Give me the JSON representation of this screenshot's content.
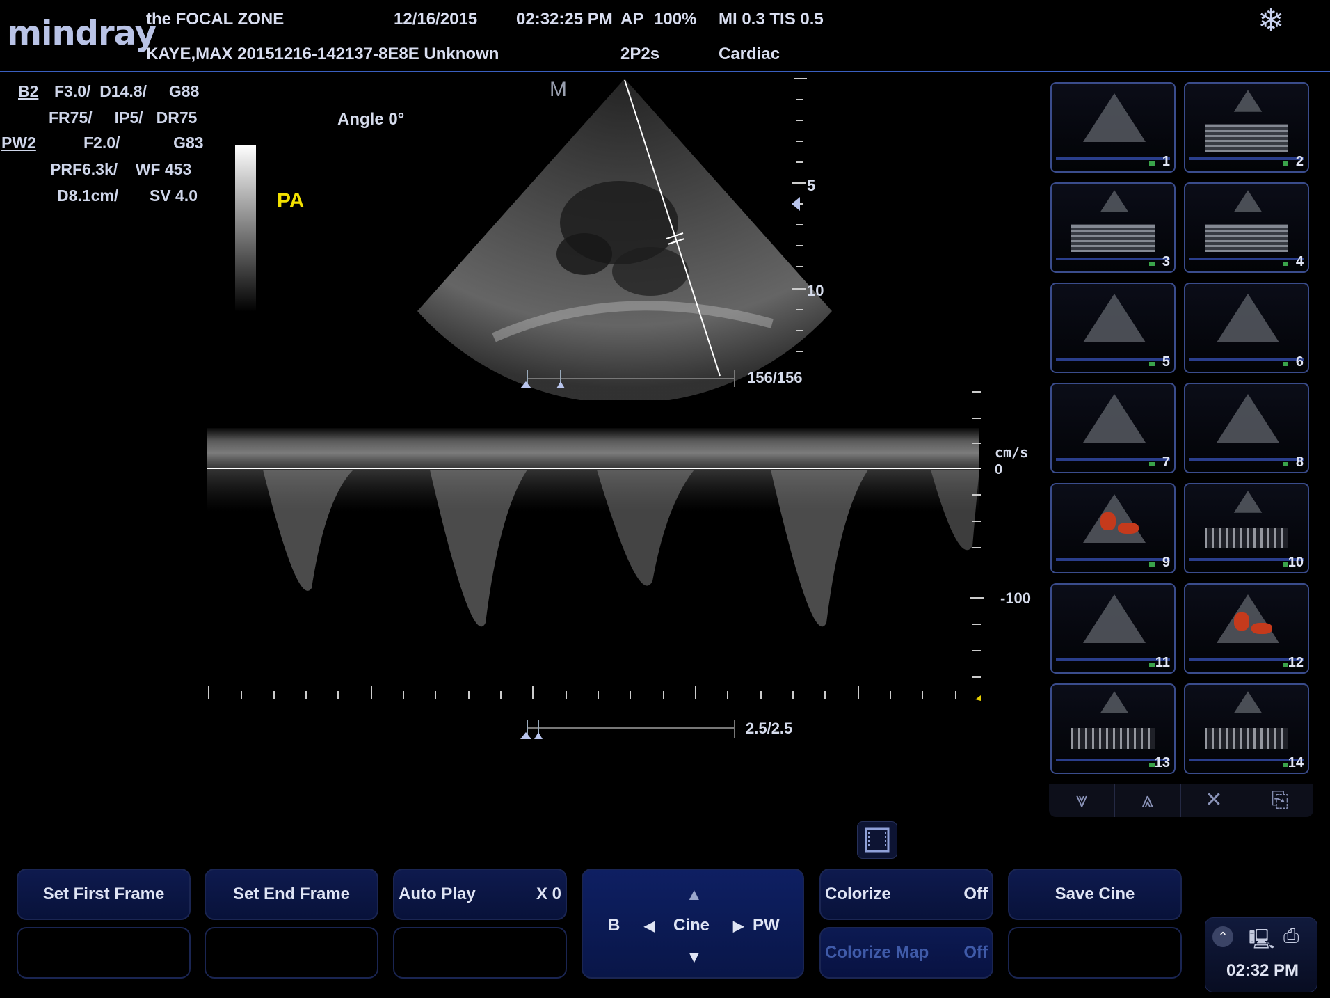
{
  "header": {
    "brand": "mindray",
    "site": "the FOCAL ZONE",
    "date": "12/16/2015",
    "time": "02:32:25 PM",
    "ap": "AP",
    "ap_value": "100%",
    "mi_tis": "MI 0.3 TIS 0.5",
    "patient": "KAYE,MAX 20151216-142137-8E8E Unknown",
    "probe": "2P2s",
    "exam": "Cardiac",
    "freeze_icon": "snowflake-icon"
  },
  "params": {
    "b_label": "B2",
    "b_line1": "F3.0/  D14.8/     G88",
    "b_line2": "FR75/     IP5/   DR75",
    "pw_label": "PW2",
    "pw_line1": "F2.0/            G83",
    "pw_line2": "PRF6.3k/    WF 453",
    "pw_line3": "D8.1cm/       SV 4.0"
  },
  "image": {
    "angle": "Angle 0°",
    "annotation": "PA",
    "marker": "M",
    "depth_5": "5",
    "depth_10": "10",
    "frame_counter": "156/156",
    "velocity_unit": "cm/s",
    "velocity_zero": "0",
    "velocity_neg100": "-100",
    "spectrum_counter": "2.5/2.5"
  },
  "thumbnails": [
    {
      "num": "1",
      "kind": "cone"
    },
    {
      "num": "2",
      "kind": "strip"
    },
    {
      "num": "3",
      "kind": "strip"
    },
    {
      "num": "4",
      "kind": "strip"
    },
    {
      "num": "5",
      "kind": "cone"
    },
    {
      "num": "6",
      "kind": "cone"
    },
    {
      "num": "7",
      "kind": "cone"
    },
    {
      "num": "8",
      "kind": "cone"
    },
    {
      "num": "9",
      "kind": "color"
    },
    {
      "num": "10",
      "kind": "doppler"
    },
    {
      "num": "11",
      "kind": "cone"
    },
    {
      "num": "12",
      "kind": "color"
    },
    {
      "num": "13",
      "kind": "doppler"
    },
    {
      "num": "14",
      "kind": "doppler"
    }
  ],
  "thumb_nav": {
    "down": "⩔",
    "up": "⩓",
    "close": "✕",
    "export": "⎘"
  },
  "buttons": {
    "set_first_frame": "Set First Frame",
    "set_end_frame": "Set End Frame",
    "auto_play": "Auto Play",
    "auto_play_value": "X 0",
    "colorize": "Colorize",
    "colorize_value": "Off",
    "colorize_map": "Colorize Map",
    "colorize_map_value": "Off",
    "save_cine": "Save Cine"
  },
  "cine": {
    "label": "Cine",
    "left": "B",
    "right": "PW",
    "up_arrow": "▲",
    "down_arrow": "▼",
    "left_arrow": "◀",
    "right_arrow": "▶"
  },
  "tray": {
    "clock": "02:32 PM"
  }
}
